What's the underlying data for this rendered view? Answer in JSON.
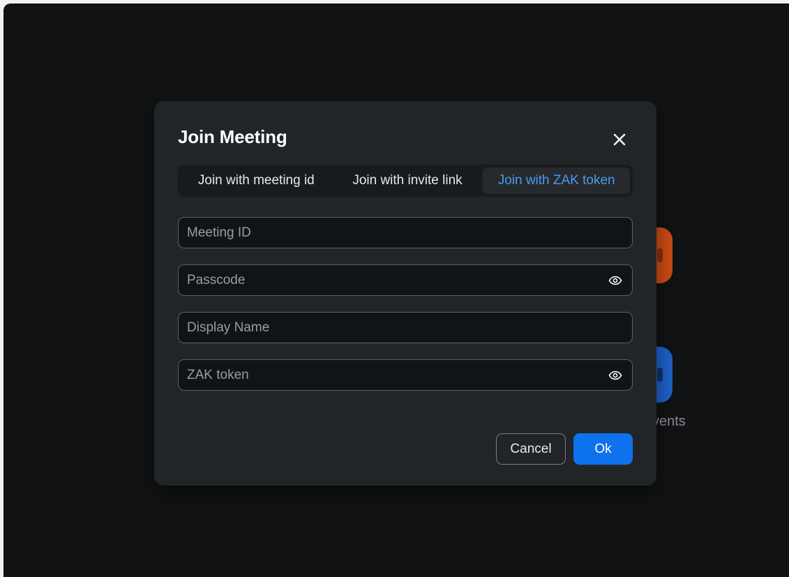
{
  "background": {
    "tile_label_1": "",
    "tile_label_2": "vents",
    "tile_colors": [
      "#c94a14",
      "#1e5fc7"
    ]
  },
  "dialog": {
    "title": "Join Meeting",
    "close_icon": "close-icon",
    "tabs": [
      {
        "label": "Join with meeting id",
        "active": false
      },
      {
        "label": "Join with invite link",
        "active": false
      },
      {
        "label": "Join with ZAK token",
        "active": true
      }
    ],
    "fields": {
      "meeting_id": {
        "placeholder": "Meeting ID",
        "value": ""
      },
      "passcode": {
        "placeholder": "Passcode",
        "value": "",
        "icon": "eye-icon"
      },
      "display_name": {
        "placeholder": "Display Name",
        "value": ""
      },
      "zak_token": {
        "placeholder": "ZAK token",
        "value": "",
        "icon": "eye-icon"
      }
    },
    "buttons": {
      "cancel": "Cancel",
      "ok": "Ok"
    }
  },
  "colors": {
    "accent": "#0e72ed",
    "active_tab_text": "#4a9bf0",
    "dialog_bg": "#212527"
  }
}
